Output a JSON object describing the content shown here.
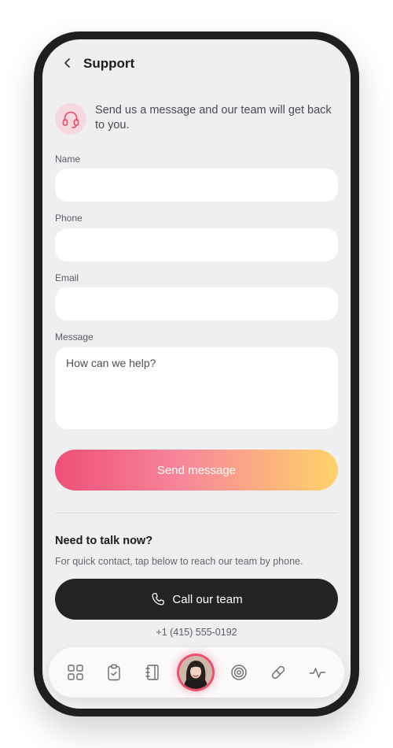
{
  "header": {
    "title": "Support",
    "back_icon": "chevron-left-icon"
  },
  "intro": {
    "icon": "headset-icon",
    "text": "Send us a message and our team will get back to you."
  },
  "form": {
    "name_label": "Name",
    "name_value": "",
    "phone_label": "Phone",
    "phone_value": "",
    "email_label": "Email",
    "email_value": "",
    "message_label": "Message",
    "message_placeholder": "How can we help?",
    "message_value": "",
    "send_label": "Send message"
  },
  "talk": {
    "title": "Need to talk now?",
    "subtitle": "For quick contact, tap below to reach our team by phone.",
    "call_label": "Call our team",
    "call_icon": "phone-icon",
    "phone_number": "+1 (415) 555-0192"
  },
  "colors": {
    "accent_pink": "#ef4f78",
    "accent_yellow": "#ffd36a",
    "dark_button": "#242426"
  },
  "tabbar": {
    "icons": [
      "grid-icon",
      "clipboard-check-icon",
      "notebook-icon",
      "avatar",
      "target-icon",
      "pill-icon",
      "pulse-icon"
    ]
  }
}
